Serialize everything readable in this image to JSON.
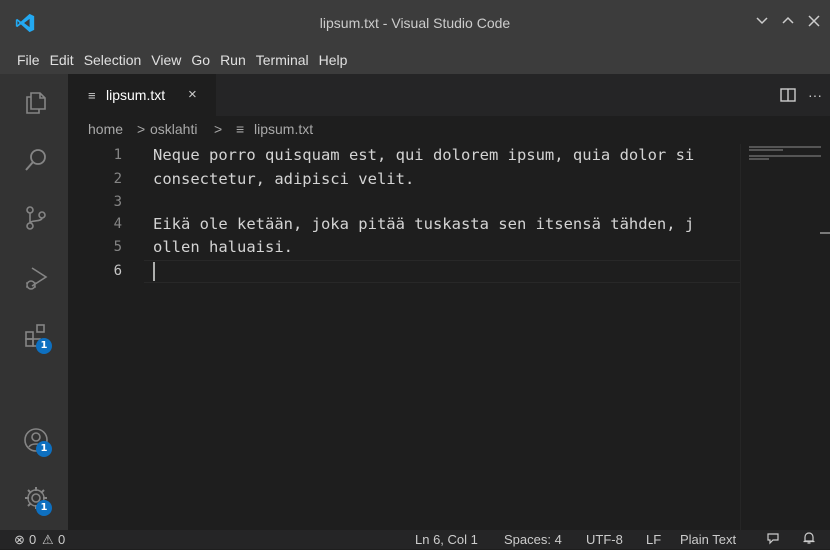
{
  "window": {
    "title": "lipsum.txt - Visual Studio Code"
  },
  "menu": [
    "File",
    "Edit",
    "Selection",
    "View",
    "Go",
    "Run",
    "Terminal",
    "Help"
  ],
  "activity": {
    "extensions_badge": "1",
    "accounts_badge": "1",
    "settings_badge": "1"
  },
  "tab": {
    "label": "lipsum.txt",
    "close": "×"
  },
  "breadcrumb": {
    "home": "home",
    "sep1": ">",
    "folder": "osklahti",
    "sep2": ">",
    "file": "lipsum.txt"
  },
  "editor": {
    "lines": [
      {
        "num": "1",
        "text": "Neque porro quisquam est, qui dolorem ipsum, quia dolor si"
      },
      {
        "num": "2",
        "text": "consectetur, adipisci velit."
      },
      {
        "num": "3",
        "text": ""
      },
      {
        "num": "4",
        "text": "Eikä ole ketään, joka pitää tuskasta sen itsensä tähden, j"
      },
      {
        "num": "5",
        "text": "ollen haluaisi."
      },
      {
        "num": "6",
        "text": ""
      }
    ]
  },
  "status": {
    "errors": "0",
    "warnings": "0",
    "position": "Ln 6, Col 1",
    "spaces": "Spaces: 4",
    "encoding": "UTF-8",
    "eol": "LF",
    "language": "Plain Text"
  },
  "colors": {
    "titlebar": "#3c3c3c",
    "activitybar": "#333333",
    "editor": "#1e1e1e",
    "badge": "#0e70c0",
    "logo": "#23a9f2"
  }
}
